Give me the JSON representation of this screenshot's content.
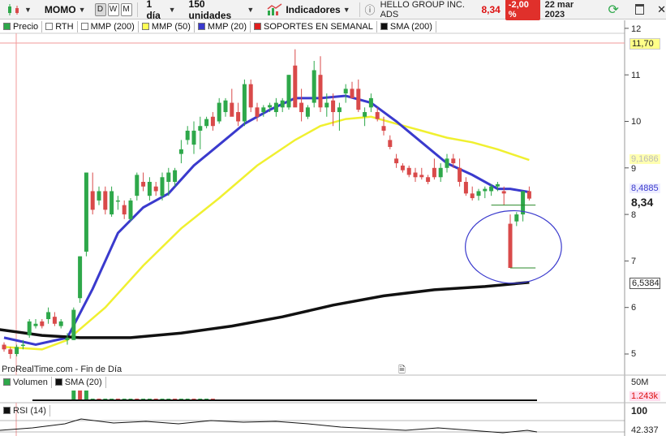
{
  "toolbar": {
    "ticker": "MOMO",
    "periods": [
      "D",
      "W",
      "M"
    ],
    "interval": "1 día",
    "units": "150 unidades",
    "indicators_label": "Indicadores",
    "company": "HELLO GROUP INC.  ADS",
    "last_price": "8,34",
    "change": "-2,00 %",
    "date": "22 mar 2023"
  },
  "legend": {
    "items": [
      {
        "label": "Precio",
        "color": "#2ea84a"
      },
      {
        "label": "RTH",
        "color": "#ffffff"
      },
      {
        "label": "MMP (200)",
        "color": "#ffffff"
      },
      {
        "label": "MMP (50)",
        "color": "#ffff55"
      },
      {
        "label": "MMP (20)",
        "color": "#3a3acd"
      },
      {
        "label": "SOPORTES EN SEMANAL",
        "color": "#e02020"
      },
      {
        "label": "SMA (200)",
        "color": "#111111"
      }
    ]
  },
  "price_axis": {
    "ticks": [
      "12",
      "11",
      "10",
      "9",
      "8",
      "7",
      "6",
      "5"
    ],
    "labels": {
      "top": "11,70",
      "mmp50": "9,1686",
      "mmp20": "8,4885",
      "last": "8,34",
      "sma200": "6,5384"
    }
  },
  "watermark": "ProRealTime.com - Fin de Día",
  "volume_panel": {
    "label": "Volumen",
    "sma_label": "SMA (20)",
    "axis_top": "50M",
    "value": "1.243k"
  },
  "rsi_panel": {
    "label": "RSI (14)",
    "axis_top": "100",
    "value": "42.337"
  },
  "colors": {
    "up": "#2ea84a",
    "down": "#d94a4a",
    "mmp20": "#3a3acd",
    "mmp50": "#f0f030",
    "sma200": "#111111",
    "circle": "#3a3acd"
  },
  "chart_data": {
    "type": "candlestick",
    "ylim": [
      4.85,
      12.2
    ],
    "y_ticks": [
      5,
      6,
      7,
      8,
      9,
      10,
      11,
      12
    ],
    "candles": [
      [
        5.2,
        5.25,
        5.05,
        5.1
      ],
      [
        5.1,
        5.15,
        4.9,
        5.0
      ],
      [
        5.0,
        5.2,
        4.95,
        5.15
      ],
      [
        5.2,
        5.3,
        5.1,
        5.2
      ],
      [
        5.4,
        5.75,
        5.35,
        5.7
      ],
      [
        5.6,
        5.75,
        5.55,
        5.65
      ],
      [
        5.7,
        5.75,
        5.55,
        5.6
      ],
      [
        5.75,
        6.0,
        5.65,
        5.9
      ],
      [
        5.8,
        5.9,
        5.6,
        5.65
      ],
      [
        5.6,
        5.75,
        5.55,
        5.7
      ],
      [
        5.3,
        5.45,
        5.2,
        5.35
      ],
      [
        5.3,
        6.0,
        5.3,
        5.95
      ],
      [
        6.2,
        7.1,
        6.1,
        7.1
      ],
      [
        7.2,
        8.9,
        7.1,
        8.9
      ],
      [
        8.5,
        8.9,
        8.0,
        8.1
      ],
      [
        8.3,
        8.6,
        8.2,
        8.5
      ],
      [
        8.5,
        8.6,
        8.0,
        8.1
      ],
      [
        8.0,
        8.6,
        7.95,
        8.5
      ],
      [
        8.3,
        8.4,
        8.1,
        8.3
      ],
      [
        8.2,
        8.3,
        7.9,
        8.0
      ],
      [
        7.9,
        8.35,
        7.85,
        8.3
      ],
      [
        8.4,
        8.9,
        8.3,
        8.85
      ],
      [
        8.7,
        8.9,
        8.5,
        8.6
      ],
      [
        8.4,
        8.8,
        8.3,
        8.7
      ],
      [
        8.6,
        8.7,
        8.4,
        8.5
      ],
      [
        8.4,
        8.9,
        8.3,
        8.8
      ],
      [
        8.7,
        9.0,
        8.4,
        8.9
      ],
      [
        8.7,
        9.0,
        8.6,
        8.95
      ],
      [
        9.3,
        9.6,
        9.1,
        9.4
      ],
      [
        9.6,
        9.9,
        9.5,
        9.8
      ],
      [
        9.5,
        10.0,
        9.3,
        9.8
      ],
      [
        9.8,
        10.1,
        9.4,
        9.9
      ],
      [
        9.9,
        10.1,
        9.85,
        10.05
      ],
      [
        10.1,
        10.2,
        9.8,
        9.9
      ],
      [
        10.0,
        10.5,
        9.95,
        10.4
      ],
      [
        10.2,
        10.5,
        10.1,
        10.45
      ],
      [
        10.4,
        10.7,
        10.2,
        10.1
      ],
      [
        10.2,
        10.4,
        9.9,
        10.0
      ],
      [
        10.0,
        10.9,
        9.9,
        10.8
      ],
      [
        10.8,
        10.9,
        10.2,
        10.3
      ],
      [
        10.3,
        10.4,
        10.0,
        10.1
      ],
      [
        10.2,
        10.35,
        10.1,
        10.3
      ],
      [
        10.3,
        10.4,
        10.2,
        10.35
      ],
      [
        10.2,
        10.5,
        10.1,
        10.4
      ],
      [
        10.3,
        10.5,
        10.2,
        10.45
      ],
      [
        10.3,
        11.0,
        10.25,
        11.0
      ],
      [
        11.2,
        11.55,
        10.8,
        10.3
      ],
      [
        10.4,
        10.7,
        10.0,
        10.2
      ],
      [
        10.1,
        10.35,
        10.05,
        10.3
      ],
      [
        10.4,
        11.3,
        10.3,
        11.1
      ],
      [
        11.0,
        11.4,
        10.2,
        10.3
      ],
      [
        10.3,
        10.6,
        10.1,
        10.4
      ],
      [
        10.45,
        10.6,
        9.9,
        10.2
      ],
      [
        10.2,
        10.4,
        9.8,
        10.3
      ],
      [
        10.6,
        10.8,
        10.4,
        10.7
      ],
      [
        10.7,
        10.85,
        10.5,
        10.5
      ],
      [
        10.7,
        10.9,
        10.2,
        10.25
      ],
      [
        10.1,
        10.3,
        9.9,
        10.2
      ],
      [
        10.3,
        10.6,
        10.2,
        10.5
      ],
      [
        10.2,
        10.3,
        10.0,
        10.05
      ],
      [
        9.9,
        10.1,
        9.7,
        9.8
      ],
      [
        9.6,
        9.7,
        9.4,
        9.45
      ],
      [
        9.2,
        9.3,
        9.0,
        9.1
      ],
      [
        9.05,
        9.1,
        8.9,
        8.95
      ],
      [
        9.0,
        9.05,
        8.8,
        8.85
      ],
      [
        8.9,
        9.0,
        8.7,
        8.8
      ],
      [
        8.85,
        9.0,
        8.75,
        8.8
      ],
      [
        8.8,
        8.85,
        8.65,
        8.7
      ],
      [
        9.0,
        9.2,
        8.75,
        8.8
      ],
      [
        8.8,
        9.1,
        8.7,
        9.0
      ],
      [
        9.0,
        9.3,
        8.9,
        9.2
      ],
      [
        9.2,
        9.3,
        9.0,
        9.1
      ],
      [
        9.0,
        9.2,
        8.6,
        8.7
      ],
      [
        8.7,
        8.8,
        8.4,
        8.45
      ],
      [
        8.45,
        8.6,
        8.3,
        8.35
      ],
      [
        8.4,
        8.55,
        8.3,
        8.5
      ],
      [
        8.5,
        8.6,
        8.35,
        8.55
      ],
      [
        8.5,
        8.65,
        8.4,
        8.6
      ],
      [
        8.6,
        8.7,
        8.5,
        8.65
      ],
      [
        8.5,
        8.6,
        8.2,
        8.45
      ],
      [
        7.8,
        8.0,
        7.45,
        6.85
      ],
      [
        7.85,
        8.05,
        7.75,
        8.0
      ],
      [
        8.0,
        8.5,
        7.85,
        8.5
      ],
      [
        8.5,
        8.6,
        8.3,
        8.34
      ]
    ],
    "mmp20": [
      [
        0,
        5.35
      ],
      [
        5,
        5.2
      ],
      [
        10,
        5.35
      ],
      [
        14,
        6.4
      ],
      [
        18,
        7.6
      ],
      [
        22,
        8.15
      ],
      [
        26,
        8.45
      ],
      [
        30,
        9.05
      ],
      [
        34,
        9.5
      ],
      [
        38,
        9.95
      ],
      [
        42,
        10.25
      ],
      [
        46,
        10.5
      ],
      [
        50,
        10.5
      ],
      [
        54,
        10.55
      ],
      [
        58,
        10.4
      ],
      [
        62,
        10.0
      ],
      [
        66,
        9.55
      ],
      [
        70,
        9.1
      ],
      [
        74,
        8.85
      ],
      [
        78,
        8.55
      ],
      [
        80,
        8.55
      ],
      [
        83,
        8.48
      ]
    ],
    "mmp50": [
      [
        0,
        5.15
      ],
      [
        6,
        5.1
      ],
      [
        10,
        5.3
      ],
      [
        16,
        6.0
      ],
      [
        22,
        6.9
      ],
      [
        28,
        7.7
      ],
      [
        34,
        8.35
      ],
      [
        40,
        9.05
      ],
      [
        46,
        9.6
      ],
      [
        50,
        9.9
      ],
      [
        54,
        10.05
      ],
      [
        58,
        10.1
      ],
      [
        62,
        9.95
      ],
      [
        66,
        9.8
      ],
      [
        70,
        9.65
      ],
      [
        74,
        9.55
      ],
      [
        78,
        9.4
      ],
      [
        83,
        9.17
      ]
    ],
    "sma200": [
      [
        -2,
        5.55
      ],
      [
        6,
        5.4
      ],
      [
        12,
        5.35
      ],
      [
        20,
        5.35
      ],
      [
        28,
        5.45
      ],
      [
        36,
        5.6
      ],
      [
        44,
        5.8
      ],
      [
        52,
        6.05
      ],
      [
        60,
        6.25
      ],
      [
        68,
        6.38
      ],
      [
        76,
        6.45
      ],
      [
        83,
        6.54
      ]
    ],
    "support_lines": [
      [
        77,
        8.2,
        84,
        8.2
      ],
      [
        80,
        6.85,
        84,
        6.85
      ]
    ],
    "annotation_circle": {
      "cx": 80.5,
      "cy": 7.3,
      "rx": 7.6,
      "ry": 0.78
    }
  }
}
